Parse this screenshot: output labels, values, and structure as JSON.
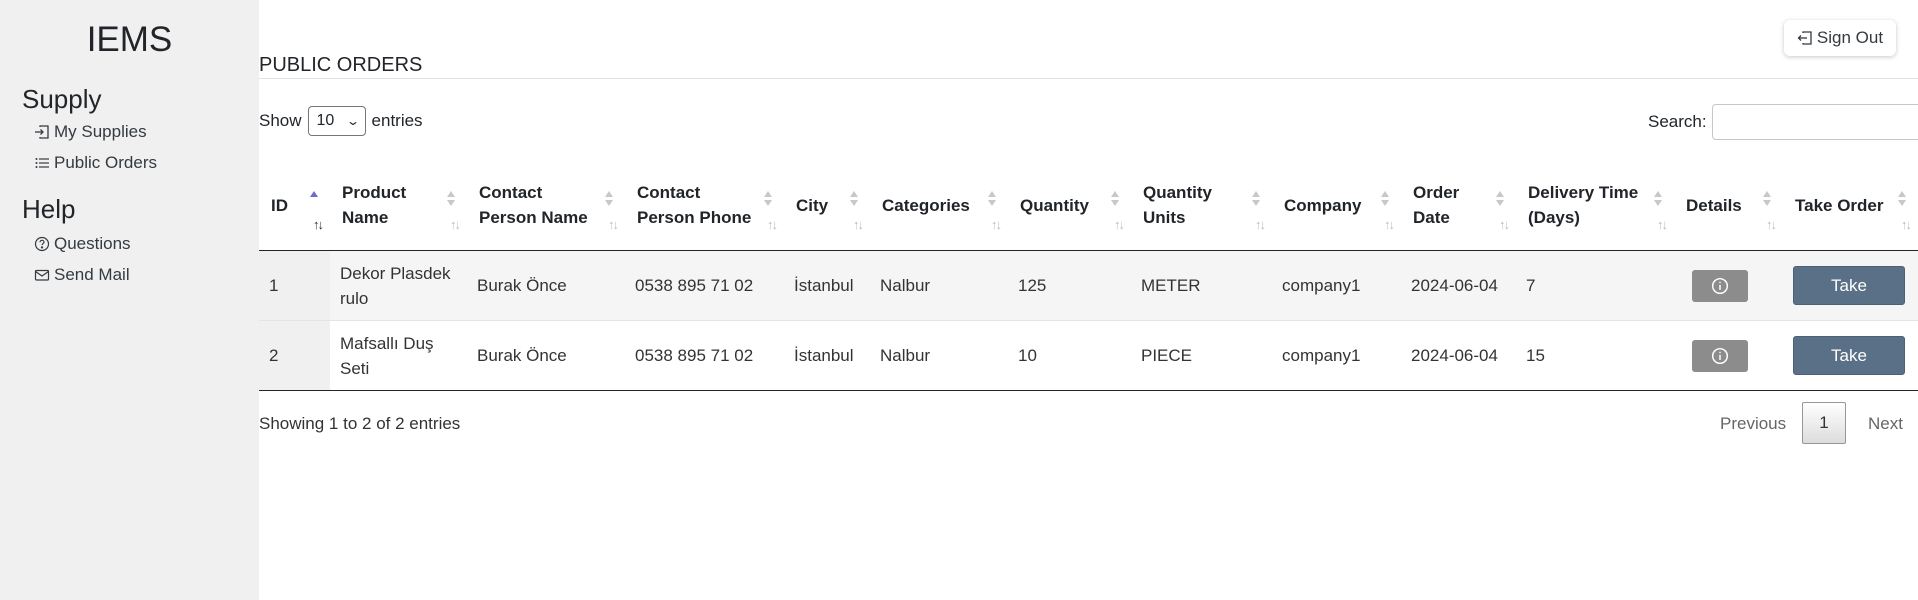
{
  "app": {
    "title": "IEMS"
  },
  "sidebar": {
    "sections": [
      {
        "title": "Supply",
        "items": [
          {
            "label": "My Supplies",
            "icon": "box-arrow-in-right-icon"
          },
          {
            "label": "Public Orders",
            "icon": "list-icon"
          }
        ]
      },
      {
        "title": "Help",
        "items": [
          {
            "label": "Questions",
            "icon": "question-circle-icon"
          },
          {
            "label": "Send Mail",
            "icon": "envelope-icon"
          }
        ]
      }
    ]
  },
  "header": {
    "sign_out_label": "Sign Out",
    "sign_out_icon": "box-arrow-left-icon"
  },
  "page": {
    "title": "PUBLIC ORDERS"
  },
  "controls": {
    "show_label": "Show",
    "page_size": "10",
    "entries_label": "entries",
    "search_label": "Search:",
    "search_value": ""
  },
  "table": {
    "columns": [
      "ID",
      "Product Name",
      "Contact Person Name",
      "Contact Person Phone",
      "City",
      "Categories",
      "Quantity",
      "Quantity Units",
      "Company",
      "Order Date",
      "Delivery Time (Days)",
      "Details",
      "Take Order"
    ],
    "sorted_column": "ID",
    "sort_direction": "ascending",
    "rows": [
      {
        "id": "1",
        "product": "Dekor Plasdek rulo",
        "contact_name": "Burak Önce",
        "phone": "0538 895 71 02",
        "city": "İstanbul",
        "category": "Nalbur",
        "quantity": "125",
        "unit": "METER",
        "company": "company1",
        "order_date": "2024-06-04",
        "delivery_days": "7",
        "details_icon": "info-circle-icon",
        "take_label": "Take"
      },
      {
        "id": "2",
        "product": "Mafsallı Duş Seti",
        "contact_name": "Burak Önce",
        "phone": "0538 895 71 02",
        "city": "İstanbul",
        "category": "Nalbur",
        "quantity": "10",
        "unit": "PIECE",
        "company": "company1",
        "order_date": "2024-06-04",
        "delivery_days": "15",
        "details_icon": "info-circle-icon",
        "take_label": "Take"
      }
    ]
  },
  "footer": {
    "info": "Showing 1 to 2 of 2 entries",
    "previous": "Previous",
    "current_page": "1",
    "next": "Next"
  },
  "colors": {
    "sidebar_bg": "#f0f0f0",
    "take_button": "#5a7086",
    "details_button": "#8c8c8c"
  }
}
